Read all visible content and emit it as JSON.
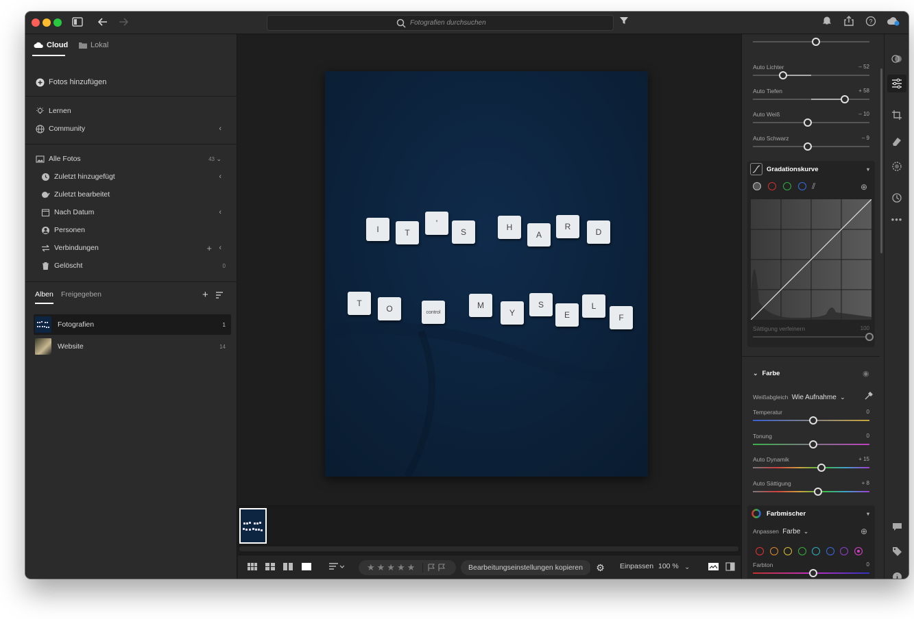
{
  "titlebar": {
    "search_placeholder": "Fotografien durchsuchen"
  },
  "left": {
    "tabs": [
      {
        "label": "Cloud",
        "active": true
      },
      {
        "label": "Lokal",
        "active": false
      }
    ],
    "add_photos": "Fotos hinzufügen",
    "learn": "Lernen",
    "community": "Community",
    "all_photos": {
      "label": "Alle Fotos",
      "count": "43"
    },
    "items": [
      {
        "label": "Zuletzt hinzugefügt"
      },
      {
        "label": "Zuletzt bearbeitet"
      },
      {
        "label": "Nach Datum"
      },
      {
        "label": "Personen"
      },
      {
        "label": "Verbindungen"
      },
      {
        "label": "Gelöscht",
        "count": "0"
      }
    ],
    "album_tabs": [
      {
        "label": "Alben",
        "active": true
      },
      {
        "label": "Freigegeben",
        "active": false
      }
    ],
    "albums": [
      {
        "label": "Fotografien",
        "count": "1",
        "active": true
      },
      {
        "label": "Website",
        "count": "14",
        "active": false
      }
    ]
  },
  "photo": {
    "background_color": "#0d2540",
    "tiles_line1": [
      "I",
      "T",
      "'",
      "S",
      "H",
      "A",
      "R",
      "D"
    ],
    "tiles_line2": [
      "T",
      "O",
      "control",
      "M",
      "Y",
      "S",
      "E",
      "L",
      "F"
    ]
  },
  "bottombar": {
    "stars": "★★★★★",
    "copy_settings": "Bearbeitungseinstellungen kopieren",
    "fit": "Einpassen",
    "zoom": "100 %"
  },
  "right": {
    "sliders_top": [
      {
        "label": "Auto Lichter",
        "value": "– 52",
        "pos": 0.26
      },
      {
        "label": "Auto Tiefen",
        "value": "+ 58",
        "pos": 0.79
      },
      {
        "label": "Auto Weiß",
        "value": "– 10",
        "pos": 0.47
      },
      {
        "label": "Auto Schwarz",
        "value": "– 9",
        "pos": 0.47
      }
    ],
    "top_slider_pos": 0.54,
    "curve": {
      "title": "Gradationskurve",
      "refine_label": "Sättigung verfeinern",
      "refine_value": "100"
    },
    "color": {
      "title": "Farbe",
      "wb_label": "Weißabgleich",
      "wb_value": "Wie Aufnahme",
      "sliders": [
        {
          "label": "Temperatur",
          "value": "0",
          "pos": 0.52
        },
        {
          "label": "Tonung",
          "value": "0",
          "pos": 0.52
        },
        {
          "label": "Auto Dynamik",
          "value": "+ 15",
          "pos": 0.59
        },
        {
          "label": "Auto Sättigung",
          "value": "+ 8",
          "pos": 0.56
        }
      ]
    },
    "mixer": {
      "title": "Farbmischer",
      "adjust_label": "Anpassen",
      "adjust_value": "Farbe",
      "hue_label": "Farbton",
      "hue_value": "0",
      "hue_pos": 0.52,
      "dot_colors": [
        "#e03434",
        "#e08a2a",
        "#d8c030",
        "#38b040",
        "#30b0c0",
        "#3a6ae0",
        "#9040d0",
        "#d040c0"
      ]
    }
  }
}
